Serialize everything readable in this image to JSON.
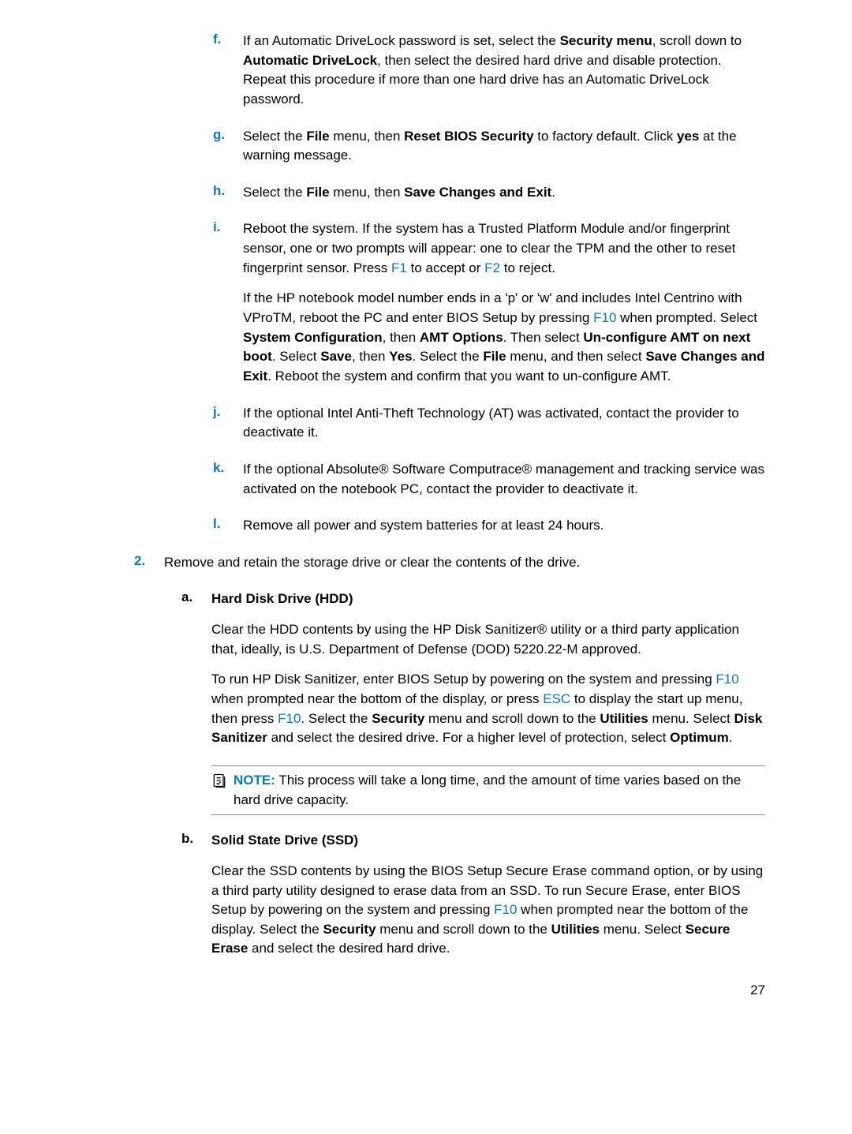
{
  "items": {
    "f": {
      "p1_pre": "If an Automatic DriveLock password is set, select the ",
      "b1": "Security menu",
      "mid1": ", scroll down to ",
      "b2": "Automatic DriveLock",
      "tail": ", then select the desired hard drive and disable protection. Repeat this procedure if more than one hard drive has an Automatic DriveLock password."
    },
    "g": {
      "pre": "Select the ",
      "b1": "File",
      "mid1": " menu, then ",
      "b2": "Reset BIOS Security",
      "mid2": " to factory default. Click ",
      "b3": "yes",
      "tail": " at the warning message."
    },
    "h": {
      "pre": "Select the ",
      "b1": "File",
      "mid": " menu, then ",
      "b2": "Save Changes and Exit",
      "tail": "."
    },
    "i": {
      "p1a": "Reboot the system. If the system has a Trusted Platform Module and/or fingerprint sensor, one or two prompts will appear: one to clear the TPM and the other to reset fingerprint sensor. Press ",
      "k1": "F1",
      "p1b": " to accept or ",
      "k2": "F2",
      "p1c": " to reject.",
      "p2a": "If the HP notebook model number ends in a 'p' or 'w' and includes Intel Centrino with VProTM, reboot the PC and enter BIOS Setup by pressing ",
      "k3": "F10",
      "p2b": " when prompted. Select ",
      "b1": "System Configuration",
      "p2c": ", then ",
      "b2": "AMT Options",
      "p2d": ". Then select ",
      "b3": "Un-configure AMT on next boot",
      "p2e": ". Select ",
      "b4": "Save",
      "p2f": ", then ",
      "b5": "Yes",
      "p2g": ". Select the ",
      "b6": "File",
      "p2h": " menu, and then select ",
      "b7": "Save Changes and Exit",
      "p2i": ". Reboot the system and confirm that you want to un-configure AMT."
    },
    "j": "If the optional Intel Anti-Theft Technology (AT) was activated, contact the provider to deactivate it.",
    "k": "If the optional Absolute® Software Computrace® management and tracking service was activated on the notebook PC, contact the provider to deactivate it.",
    "l": "Remove all power and system batteries for at least 24 hours."
  },
  "step2": "Remove and retain the storage drive or clear the contents of the drive.",
  "sub": {
    "a": {
      "title": "Hard Disk Drive (HDD)",
      "p1": "Clear the HDD contents by using the HP Disk Sanitizer® utility or a third party application that, ideally, is U.S. Department of Defense (DOD) 5220.22-M approved.",
      "p2a": "To run HP Disk Sanitizer, enter BIOS Setup by powering on the system and pressing ",
      "k1": "F10",
      "p2b": " when prompted near the bottom of the display, or press ",
      "k2": "ESC",
      "p2c": " to display the start up menu, then press ",
      "k3": "F10",
      "p2d": ". Select the ",
      "b1": "Security",
      "p2e": " menu and scroll down to the ",
      "b2": "Utilities",
      "p2f": " menu. Select ",
      "b3": "Disk Sanitizer",
      "p2g": " and select the desired drive. For a higher level of protection, select ",
      "b4": "Optimum",
      "p2h": "."
    },
    "b": {
      "title": "Solid State Drive (SSD)",
      "p1a": "Clear the SSD contents by using the BIOS Setup Secure Erase command option, or by using a third party utility designed to erase data from an SSD. To run Secure Erase, enter BIOS Setup by powering on the system and pressing ",
      "k1": "F10",
      "p1b": " when prompted near the bottom of the display. Select the ",
      "b1": "Security",
      "p1c": " menu and scroll down to the ",
      "b2": "Utilities",
      "p1d": " menu. Select ",
      "b3": "Secure Erase",
      "p1e": " and select the desired hard drive."
    }
  },
  "note": {
    "label": "NOTE:",
    "text": "This process will take a long time, and the amount of time varies based on the hard drive capacity."
  },
  "markers": {
    "f": "f.",
    "g": "g.",
    "h": "h.",
    "i": "i.",
    "j": "j.",
    "k": "k.",
    "l": "l.",
    "two": "2.",
    "a": "a.",
    "b": "b."
  },
  "pagenum": "27"
}
